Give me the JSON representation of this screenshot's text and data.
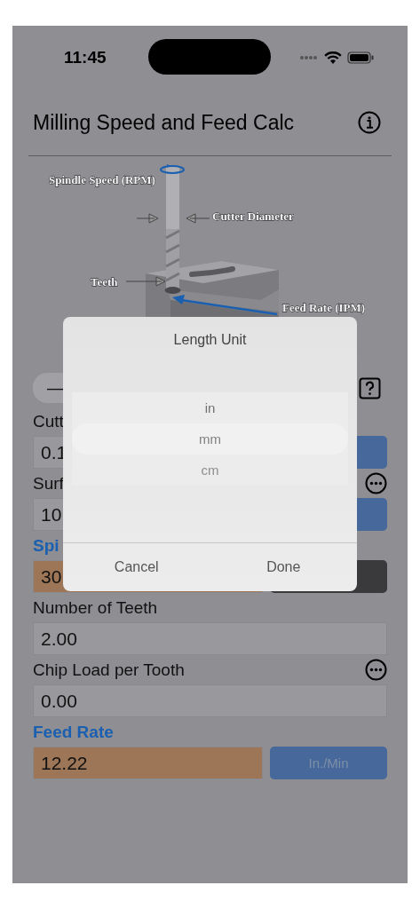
{
  "status_bar": {
    "time": "11:45"
  },
  "nav": {
    "title": "Milling Speed and Feed Calc"
  },
  "diagram": {
    "labels": [
      {
        "kind": "spindle",
        "text": "Spindle Speed (RPM)"
      },
      {
        "kind": "diameter",
        "text": "Cutter Diameter"
      },
      {
        "kind": "teeth",
        "text": "Teeth"
      },
      {
        "kind": "feed",
        "text": "Feed Rate (IPM)"
      }
    ]
  },
  "mode_control": {
    "label": "—"
  },
  "fields": [
    {
      "kind": "input",
      "label": "Cutt",
      "value": "0.1",
      "unit": {
        "kind": "blue"
      },
      "more": false
    },
    {
      "kind": "input",
      "label": "Surf",
      "value": "10",
      "unit": {
        "kind": "blue"
      },
      "more": true
    },
    {
      "kind": "result",
      "label": "Spi",
      "value": "30",
      "unit": {
        "kind": "dark"
      },
      "more": false
    },
    {
      "kind": "input",
      "label": "Number of Teeth",
      "value": "2.00",
      "more": false
    },
    {
      "kind": "input",
      "label": "Chip Load per Tooth",
      "value": "0.00",
      "more": true
    },
    {
      "kind": "result",
      "label": "Feed Rate",
      "value": "12.22",
      "unit": {
        "kind": "blue",
        "text": "In./Min"
      },
      "more": false
    }
  ],
  "dialog": {
    "title": "Length Unit",
    "picker": [
      {
        "label": "in",
        "selected": false
      },
      {
        "label": "mm",
        "selected": true
      },
      {
        "label": "cm",
        "selected": false
      }
    ],
    "buttons": [
      {
        "label": "Cancel"
      },
      {
        "label": "Done"
      }
    ]
  }
}
